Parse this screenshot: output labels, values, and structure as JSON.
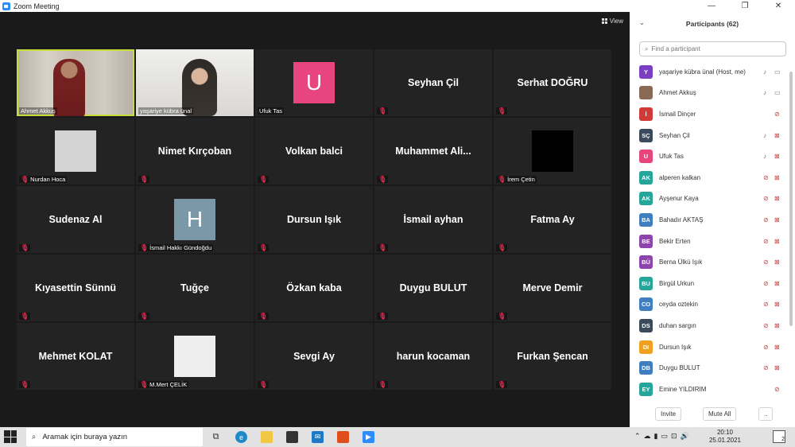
{
  "window": {
    "title": "Zoom Meeting",
    "controls": [
      "—",
      "❐",
      "✕"
    ]
  },
  "view_label": "View",
  "tiles": [
    {
      "name": "Ahmet Akkuş",
      "kind": "photo1",
      "label": "Ahmet Akkuş",
      "muted": false,
      "active": true
    },
    {
      "name": "yaşariye kübra ünal",
      "kind": "photo2",
      "label": "yaşariye kübra ünal",
      "muted": false
    },
    {
      "name": "Ufuk Tas",
      "kind": "avatar",
      "initial": "U",
      "color": "#e8457e",
      "label": "Ufuk Tas",
      "muted": false
    },
    {
      "name": "Seyhan Çil",
      "kind": "text",
      "muted": true
    },
    {
      "name": "Serhat DOĞRU",
      "kind": "text",
      "muted": true
    },
    {
      "name": "Nurdan Hoca",
      "kind": "avatar",
      "initial": "",
      "color": "#d4d4d4",
      "label": "Nurdan Hoca",
      "muted": true
    },
    {
      "name": "Nimet Kırçoban",
      "kind": "text",
      "muted": true
    },
    {
      "name": "Volkan  balci",
      "kind": "text",
      "muted": true
    },
    {
      "name": "Muhammet  Ali...",
      "kind": "text",
      "muted": true
    },
    {
      "name": "İrem Çetin",
      "kind": "avatar",
      "initial": "",
      "color": "#000000",
      "label": "İrem Çetin",
      "muted": true
    },
    {
      "name": "Sudenaz Al",
      "kind": "text",
      "muted": true
    },
    {
      "name": "İsmail Hakkı Gündoğdu",
      "kind": "avatar",
      "initial": "H",
      "color": "#7a98a8",
      "label": "İsmail Hakkı Gündoğdu",
      "muted": true
    },
    {
      "name": "Dursun Işık",
      "kind": "text",
      "muted": true
    },
    {
      "name": "İsmail ayhan",
      "kind": "text",
      "muted": true
    },
    {
      "name": "Fatma Ay",
      "kind": "text",
      "muted": true
    },
    {
      "name": "Kıyasettin Sünnü",
      "kind": "text",
      "muted": true
    },
    {
      "name": "Tuğçe",
      "kind": "text",
      "muted": true
    },
    {
      "name": "Özkan kaba",
      "kind": "text",
      "muted": true
    },
    {
      "name": "Duygu BULUT",
      "kind": "text",
      "muted": true
    },
    {
      "name": "Merve Demir",
      "kind": "text",
      "muted": true
    },
    {
      "name": "Mehmet KOLAT",
      "kind": "text",
      "muted": true
    },
    {
      "name": "M.Mert ÇELİK",
      "kind": "avatar",
      "initial": "",
      "color": "#eeeeee",
      "label": "M.Mert ÇELİK",
      "muted": true
    },
    {
      "name": "Sevgi Ay",
      "kind": "text",
      "muted": true
    },
    {
      "name": "harun kocaman",
      "kind": "text",
      "muted": true
    },
    {
      "name": "Furkan Şencan",
      "kind": "text",
      "muted": true
    }
  ],
  "panel": {
    "title": "Participants (62)",
    "search_placeholder": "Find a participant",
    "invite": "Invite",
    "mute_all": "Mute All",
    "more": "..",
    "participants": [
      {
        "initials": "Y",
        "color": "#7b3fc4",
        "name": "yaşariye kübra ünal (Host, me)",
        "mic": "on",
        "cam": "on"
      },
      {
        "initials": "",
        "color": "#8a6a55",
        "name": "Ahmet Akkuş",
        "mic": "on",
        "cam": "on"
      },
      {
        "initials": "İ",
        "color": "#d23a3a",
        "name": "İsmail Dinçer",
        "mic": "muted",
        "cam": "none"
      },
      {
        "initials": "SÇ",
        "color": "#3b4a5a",
        "name": "Seyhan Çil",
        "mic": "on",
        "cam": "off"
      },
      {
        "initials": "U",
        "color": "#e8457e",
        "name": "Ufuk Tas",
        "mic": "on",
        "cam": "off"
      },
      {
        "initials": "AK",
        "color": "#26a69a",
        "name": "alperen kalkan",
        "mic": "muted",
        "cam": "off"
      },
      {
        "initials": "AK",
        "color": "#26a69a",
        "name": "Ayşenur Kaya",
        "mic": "muted",
        "cam": "off"
      },
      {
        "initials": "BA",
        "color": "#3f7fbf",
        "name": "Bahadır AKTAŞ",
        "mic": "muted",
        "cam": "off"
      },
      {
        "initials": "BE",
        "color": "#8e44ad",
        "name": "Bekir Erten",
        "mic": "muted",
        "cam": "off"
      },
      {
        "initials": "BÜ",
        "color": "#8e44ad",
        "name": "Berna Ülkü Işık",
        "mic": "muted",
        "cam": "off"
      },
      {
        "initials": "BU",
        "color": "#26a69a",
        "name": "Birgül Urkun",
        "mic": "muted",
        "cam": "off"
      },
      {
        "initials": "CO",
        "color": "#3f7fbf",
        "name": "ceyda oztekin",
        "mic": "muted",
        "cam": "off"
      },
      {
        "initials": "DS",
        "color": "#3b4a5a",
        "name": "duhan sargın",
        "mic": "muted",
        "cam": "off"
      },
      {
        "initials": "DI",
        "color": "#f0a020",
        "name": "Dursun Işık",
        "mic": "muted",
        "cam": "off"
      },
      {
        "initials": "DB",
        "color": "#3f7fbf",
        "name": "Duygu BULUT",
        "mic": "muted",
        "cam": "off"
      },
      {
        "initials": "EY",
        "color": "#26a69a",
        "name": "Emine YILDIRIM",
        "mic": "muted",
        "cam": "none"
      }
    ]
  },
  "taskbar": {
    "search_placeholder": "Aramak için buraya yazın",
    "time": "20:10",
    "date": "25.01.2021",
    "notifications": "2"
  }
}
